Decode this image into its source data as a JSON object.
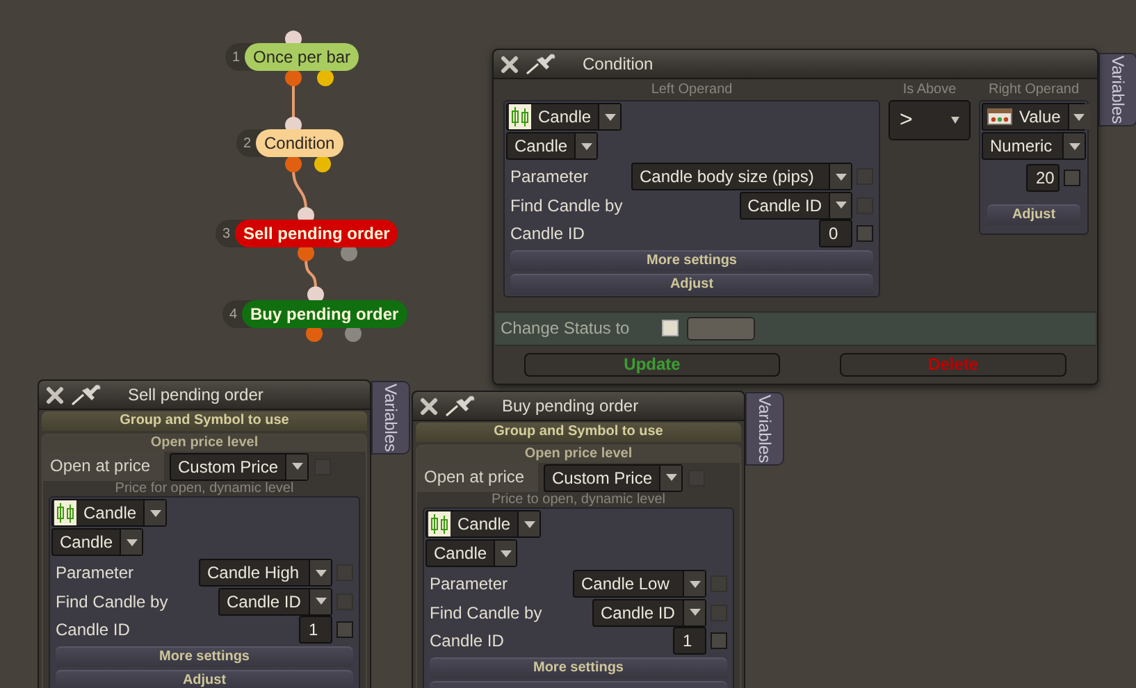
{
  "nodes": [
    {
      "number": "1",
      "label": "Once per bar",
      "color": "#a8cc60",
      "ports": [
        {
          "color": "#e06010"
        },
        {
          "color": "#e8b800"
        }
      ]
    },
    {
      "number": "2",
      "label": "Condition",
      "color": "#f8d090",
      "ports": [
        {
          "color": "#e06010"
        },
        {
          "color": "#e8b800"
        }
      ]
    },
    {
      "number": "3",
      "label": "Sell pending order",
      "color": "#d40000",
      "ports": [
        {
          "color": "#e06010"
        },
        {
          "color": "#8a8680"
        }
      ]
    },
    {
      "number": "4",
      "label": "Buy pending order",
      "color": "#107010",
      "ports": [
        {
          "color": "#e06010"
        },
        {
          "color": "#8a8680"
        }
      ]
    }
  ],
  "condition_window": {
    "title": "Condition",
    "tab": "Variables",
    "left_operand": {
      "caption": "Left Operand",
      "source": {
        "kind": "candle",
        "label": "Candle"
      },
      "type": "Candle",
      "rows": [
        {
          "kind": "dropdown",
          "label": "Parameter",
          "value": "Candle body size (pips)",
          "checked": false
        },
        {
          "kind": "dropdown",
          "label": "Find Candle by",
          "value": "Candle ID",
          "checked": false
        },
        {
          "kind": "number",
          "label": "Candle ID",
          "value": "0",
          "checked": false
        }
      ],
      "buttons": [
        "More settings",
        "Adjust"
      ]
    },
    "operator": {
      "caption": "Is Above",
      "value": ">"
    },
    "right_operand": {
      "caption": "Right Operand",
      "source": {
        "kind": "value",
        "label": "Value"
      },
      "type": "Numeric",
      "value": "20",
      "checked": false,
      "button": "Adjust"
    },
    "status": {
      "label": "Change Status to",
      "checked": false
    },
    "buttons": [
      {
        "kind": "confirm",
        "label": "Update"
      },
      {
        "kind": "danger",
        "label": "Delete"
      }
    ]
  },
  "order_windows": [
    {
      "title": "Sell pending order",
      "tab": "Variables",
      "group": "Group and Symbol to use",
      "open_price": {
        "header": "Open price level",
        "label": "Open at price",
        "value": "Custom Price",
        "checked": false,
        "caption": "Price for open, dynamic level",
        "operand": {
          "source": {
            "kind": "candle",
            "label": "Candle"
          },
          "type": "Candle",
          "rows": [
            {
              "kind": "dropdown",
              "label": "Parameter",
              "value": "Candle High",
              "checked": false
            },
            {
              "kind": "dropdown",
              "label": "Find Candle by",
              "value": "Candle ID",
              "checked": false
            },
            {
              "kind": "number",
              "label": "Candle ID",
              "value": "1",
              "checked": false
            }
          ],
          "buttons": [
            "More settings",
            "Adjust"
          ],
          "more_below": false
        }
      }
    },
    {
      "title": "Buy pending order",
      "tab": "Variables",
      "group": "Group and Symbol to use",
      "open_price": {
        "header": "Open price level",
        "label": "Open at price",
        "value": "Custom Price",
        "checked": false,
        "caption": "Price to open, dynamic level",
        "operand": {
          "source": {
            "kind": "candle",
            "label": "Candle"
          },
          "type": "Candle",
          "rows": [
            {
              "kind": "dropdown",
              "label": "Parameter",
              "value": "Candle Low",
              "checked": false
            },
            {
              "kind": "dropdown",
              "label": "Find Candle by",
              "value": "Candle ID",
              "checked": false
            },
            {
              "kind": "number",
              "label": "Candle ID",
              "value": "1",
              "checked": false
            }
          ],
          "buttons": [
            "More settings"
          ],
          "more_below": true
        }
      }
    }
  ]
}
